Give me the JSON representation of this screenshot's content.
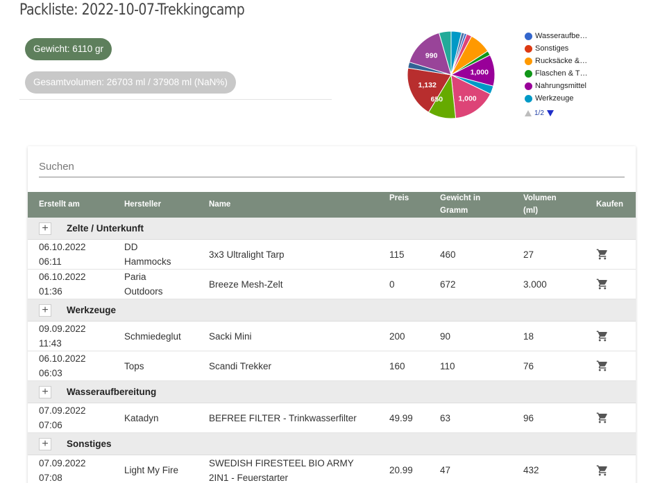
{
  "title": "Packliste: 2022-10-07-Trekkingcamp",
  "badges": {
    "weight": "Gewicht: 6110 gr",
    "volume": "Gesamtvolumen: 26703 ml / 37908 ml (NaN%)"
  },
  "chart_data": {
    "type": "pie",
    "labels": [
      "Wasseraufbe…",
      "Sonstiges",
      "Rucksäcke &…",
      "Flaschen & T…",
      "Nahrungsmittel",
      "Werkzeuge"
    ],
    "slice_labels": [
      "1,000",
      "1,000",
      "650",
      "1,132",
      "990"
    ],
    "legend_page": "1/2"
  },
  "legend": {
    "items": [
      {
        "label": "Wasseraufbe…",
        "color": "#3366cc"
      },
      {
        "label": "Sonstiges",
        "color": "#dc3912"
      },
      {
        "label": "Rucksäcke &…",
        "color": "#ff9900"
      },
      {
        "label": "Flaschen & T…",
        "color": "#109618"
      },
      {
        "label": "Nahrungsmittel",
        "color": "#990099"
      },
      {
        "label": "Werkzeuge",
        "color": "#0099c6"
      }
    ],
    "page": "1/2"
  },
  "search": {
    "placeholder": "Suchen",
    "value": ""
  },
  "table": {
    "headers": {
      "created": "Erstellt am",
      "maker": "Hersteller",
      "name": "Name",
      "price": "Preis",
      "weight_1": "Gewicht in",
      "weight_2": "Gramm",
      "volume_1": "Volumen",
      "volume_2": "(ml)",
      "buy": "Kaufen"
    },
    "groups": [
      {
        "label": "Zelte / Unterkunft",
        "rows": [
          {
            "date": "06.10.2022",
            "time": "06:11",
            "maker_1": "DD",
            "maker_2": "Hammocks",
            "name_1": "3x3 Ultralight Tarp",
            "name_2": "",
            "price": "115",
            "weight": "460",
            "volume": "27"
          },
          {
            "date": "06.10.2022",
            "time": "01:36",
            "maker_1": "Paria",
            "maker_2": "Outdoors",
            "name_1": "Breeze Mesh-Zelt",
            "name_2": "",
            "price": "0",
            "weight": "672",
            "volume": "3.000"
          }
        ]
      },
      {
        "label": "Werkzeuge",
        "rows": [
          {
            "date": "09.09.2022",
            "time": "11:43",
            "maker_1": "Schmiedeglut",
            "maker_2": "",
            "name_1": "Sacki Mini",
            "name_2": "",
            "price": "200",
            "weight": "90",
            "volume": "18"
          },
          {
            "date": "06.10.2022",
            "time": "06:03",
            "maker_1": "Tops",
            "maker_2": "",
            "name_1": "Scandi Trekker",
            "name_2": "",
            "price": "160",
            "weight": "110",
            "volume": "76"
          }
        ]
      },
      {
        "label": "Wasseraufbereitung",
        "rows": [
          {
            "date": "07.09.2022",
            "time": "07:06",
            "maker_1": "Katadyn",
            "maker_2": "",
            "name_1": "BEFREE FILTER - Trinkwasserfilter",
            "name_2": "",
            "price": "49.99",
            "weight": "63",
            "volume": "96"
          }
        ]
      },
      {
        "label": "Sonstiges",
        "rows": [
          {
            "date": "07.09.2022",
            "time": "07:08",
            "maker_1": "Light My Fire",
            "maker_2": "",
            "name_1": "SWEDISH FIRESTEEL BIO ARMY",
            "name_2": "2IN1 - Feuerstarter",
            "price": "20.99",
            "weight": "47",
            "volume": "432"
          }
        ]
      }
    ]
  }
}
